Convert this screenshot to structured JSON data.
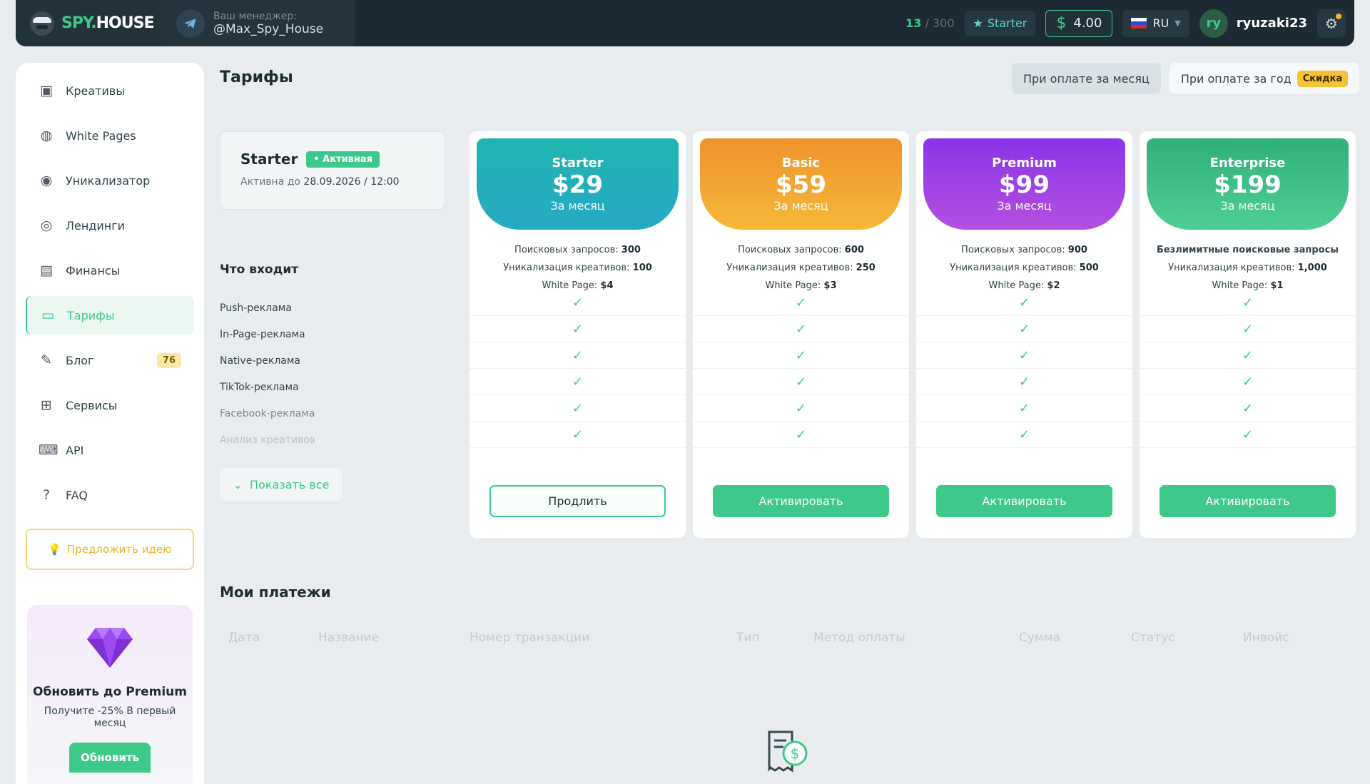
{
  "header": {
    "logo": {
      "part1": "SPY",
      "dot": ".",
      "part2": "HOUSE"
    },
    "manager_label": "Ваш менеджер:",
    "manager_name": "@Max_Spy_House",
    "requests_used": "13",
    "requests_total": "/ 300",
    "plan_badge": "Starter",
    "balance": "4.00",
    "language": "RU",
    "user_initials": "ry",
    "username": "ryuzaki23"
  },
  "sidebar": {
    "items": [
      {
        "label": "Креативы",
        "icon": "image-icon"
      },
      {
        "label": "White Pages",
        "icon": "globe-icon"
      },
      {
        "label": "Уникализатор",
        "icon": "fingerprint-icon"
      },
      {
        "label": "Лендинги",
        "icon": "target-icon"
      },
      {
        "label": "Финансы",
        "icon": "wallet-icon"
      },
      {
        "label": "Тарифы",
        "icon": "card-icon"
      },
      {
        "label": "Блог",
        "icon": "pen-icon",
        "badge": "76"
      },
      {
        "label": "Сервисы",
        "icon": "grid-icon"
      },
      {
        "label": "API",
        "icon": "api-icon"
      },
      {
        "label": "FAQ",
        "icon": "question-icon"
      }
    ],
    "idea_button": "Предложить идею",
    "promo": {
      "title": "Обновить до Premium",
      "subtitle": "Получите -25% В первый месяц",
      "button": "Обновить"
    }
  },
  "page": {
    "title": "Тарифы",
    "toggle_month": "При оплате за месяц",
    "toggle_year": "При оплате за год",
    "discount_badge": "Скидка",
    "current_plan": {
      "name": "Starter",
      "status": "Активная",
      "active_label": "Активна до",
      "active_until": "28.09.2026 / 12:00"
    },
    "features_title": "Что входит",
    "features": [
      "Push-реклама",
      "In-Page-реклама",
      "Native-реклама",
      "TikTok-реклама",
      "Facebook-реклама",
      "Анализ креативов"
    ],
    "show_all": "Показать все",
    "plans": [
      {
        "name": "Starter",
        "price": "$29",
        "period": "За месяц",
        "info": [
          {
            "label": "Поисковых запросов: ",
            "value": "300"
          },
          {
            "label": "Уникализация креативов: ",
            "value": "100"
          },
          {
            "label": "White Page: ",
            "value": "$4"
          }
        ],
        "button": "Продлить",
        "gradient": [
          "#1fb5b0",
          "#27a9c4"
        ]
      },
      {
        "name": "Basic",
        "price": "$59",
        "period": "За месяц",
        "info": [
          {
            "label": "Поисковых запросов: ",
            "value": "600"
          },
          {
            "label": "Уникализация креативов: ",
            "value": "250"
          },
          {
            "label": "White Page: ",
            "value": "$3"
          }
        ],
        "button": "Активировать",
        "gradient": [
          "#f0922b",
          "#f4b93a"
        ]
      },
      {
        "name": "Premium",
        "price": "$99",
        "period": "За месяц",
        "info": [
          {
            "label": "Поисковых запросов: ",
            "value": "900"
          },
          {
            "label": "Уникализация креативов: ",
            "value": "500"
          },
          {
            "label": "White Page: ",
            "value": "$2"
          }
        ],
        "button": "Активировать",
        "gradient": [
          "#8a34e8",
          "#b44fe0"
        ]
      },
      {
        "name": "Enterprise",
        "price": "$199",
        "period": "За месяц",
        "info": [
          {
            "label": "Безлимитные поисковые запросы",
            "value": ""
          },
          {
            "label": "Уникализация креативов: ",
            "value": "1,000"
          },
          {
            "label": "White Page: ",
            "value": "$1"
          }
        ],
        "button": "Активировать",
        "gradient": [
          "#2fb07a",
          "#4fcf93"
        ]
      }
    ],
    "payments_title": "Мои платежи",
    "payments_columns": [
      "Дата",
      "Название",
      "Номер транзакции",
      "Тип",
      "Метод оплаты",
      "Сумма",
      "Статус",
      "Инвойс"
    ]
  },
  "colors": {
    "accent": "#3ec98a",
    "header_bg": "#1c2b33",
    "badge_yellow": "#f4c232"
  }
}
